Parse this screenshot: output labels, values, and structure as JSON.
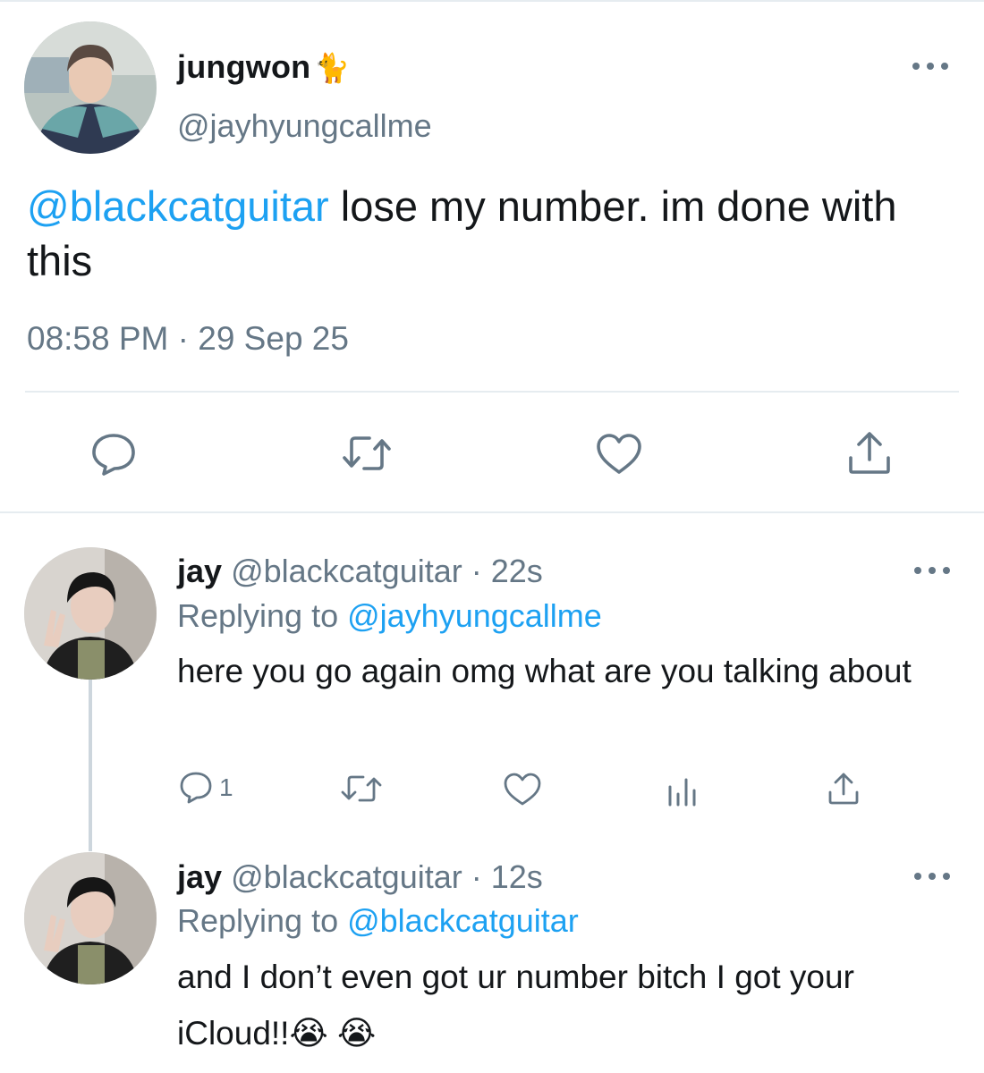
{
  "main_tweet": {
    "display_name": "jungwon",
    "name_emoji": "🐈",
    "handle": "@jayhyungcallme",
    "mention": "@blackcatguitar",
    "text": " lose my number. im done with this",
    "timestamp": "08:58 PM · 29 Sep 25",
    "actions": [
      "reply-icon",
      "retweet-icon",
      "like-icon",
      "share-icon"
    ]
  },
  "replies": [
    {
      "display_name": "jay",
      "handle_time": "@blackcatguitar · 22s",
      "replying_prefix": "Replying to ",
      "replying_to": "@jayhyungcallme",
      "text": "here you go again omg what are you talking about",
      "reply_count": "1",
      "actions": [
        "reply-icon",
        "retweet-icon",
        "like-icon",
        "analytics-icon",
        "share-icon"
      ]
    },
    {
      "display_name": "jay",
      "handle_time": "@blackcatguitar · 12s",
      "replying_prefix": "Replying to ",
      "replying_to": "@blackcatguitar",
      "text": "and I don’t even got ur number bitch I got your iCloud!!😭 😭"
    }
  ],
  "colors": {
    "accent": "#1da1f2",
    "secondary_text": "#657786",
    "divider": "#e6ecf0"
  }
}
